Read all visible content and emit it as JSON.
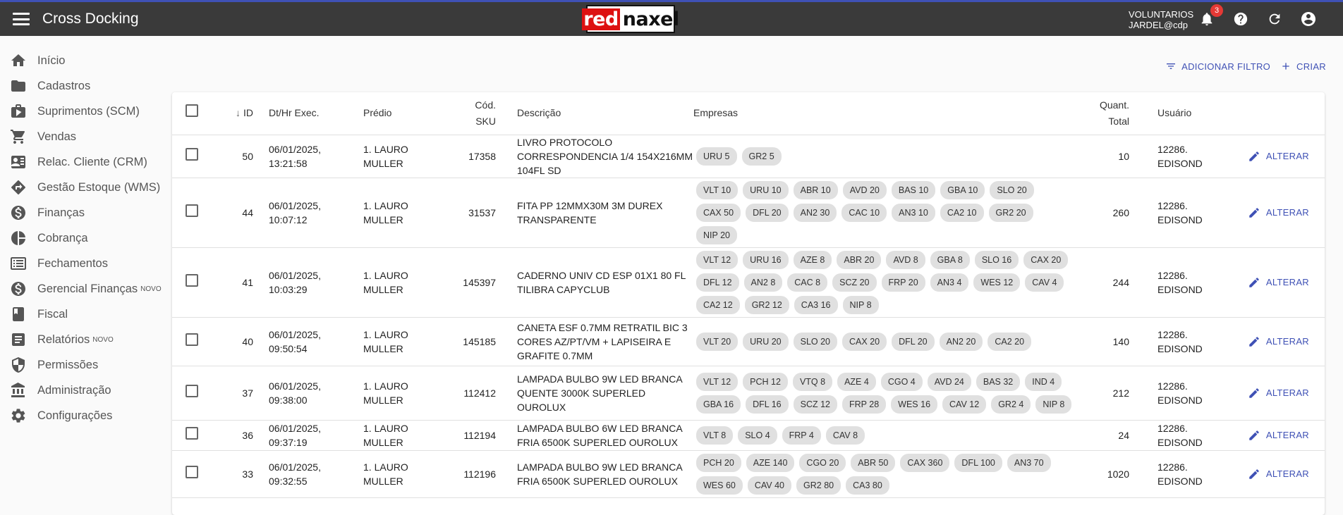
{
  "header": {
    "title": "Cross Docking",
    "logo_part1": "red",
    "logo_part2": "naxel",
    "user_line1": "VOLUNTARIOS",
    "user_line2": "JARDEL@cdp",
    "notification_count": "3"
  },
  "sidebar": {
    "items": [
      {
        "label": "Início",
        "icon": "home-icon"
      },
      {
        "label": "Cadastros",
        "icon": "folder-icon"
      },
      {
        "label": "Suprimentos (SCM)",
        "icon": "briefcase-icon"
      },
      {
        "label": "Vendas",
        "icon": "cart-icon"
      },
      {
        "label": "Relac. Cliente (CRM)",
        "icon": "contact-card-icon"
      },
      {
        "label": "Gestão Estoque (WMS)",
        "icon": "directions-icon"
      },
      {
        "label": "Finanças",
        "icon": "dollar-circle-icon"
      },
      {
        "label": "Cobrança",
        "icon": "pie-chart-icon"
      },
      {
        "label": "Fechamentos",
        "icon": "list-box-icon"
      },
      {
        "label": "Gerencial Finanças",
        "icon": "dollar-circle-icon",
        "sup": "NOVO"
      },
      {
        "label": "Fiscal",
        "icon": "book-icon"
      },
      {
        "label": "Relatórios",
        "icon": "report-icon",
        "sup": "NOVO"
      },
      {
        "label": "Permissões",
        "icon": "shield-icon"
      },
      {
        "label": "Administração",
        "icon": "bank-icon"
      },
      {
        "label": "Configurações",
        "icon": "gear-icon"
      }
    ]
  },
  "toolbar": {
    "filter_label": "ADICIONAR FILTRO",
    "create_label": "CRIAR"
  },
  "table": {
    "headers": {
      "id": "ID",
      "dt": "Dt/Hr Exec.",
      "predio": "Prédio",
      "sku_line1": "Cód.",
      "sku_line2": "SKU",
      "descricao": "Descrição",
      "empresas": "Empresas",
      "quant_line1": "Quant.",
      "quant_line2": "Total",
      "usuario": "Usuário"
    },
    "edit_label": "ALTERAR",
    "rows": [
      {
        "id": "50",
        "dt1": "06/01/2025,",
        "dt2": "13:21:58",
        "predio1": "1. LAURO",
        "predio2": "MULLER",
        "sku": "17358",
        "desc": "LIVRO PROTOCOLO CORRESPONDENCIA 1/4 154X216MM 104FL SD",
        "chips": [
          "URU 5",
          "GR2 5"
        ],
        "qt": "10",
        "usr1": "12286.",
        "usr2": "EDISOND"
      },
      {
        "id": "44",
        "dt1": "06/01/2025,",
        "dt2": "10:07:12",
        "predio1": "1. LAURO",
        "predio2": "MULLER",
        "sku": "31537",
        "desc": "FITA PP 12MMX30M 3M DUREX TRANSPARENTE",
        "chips": [
          "VLT 10",
          "URU 10",
          "ABR 10",
          "AVD 20",
          "BAS 10",
          "GBA 10",
          "SLO 20",
          "CAX 50",
          "DFL 20",
          "AN2 30",
          "CAC 10",
          "AN3 10",
          "CA2 10",
          "GR2 20",
          "NIP 20"
        ],
        "qt": "260",
        "usr1": "12286.",
        "usr2": "EDISOND"
      },
      {
        "id": "41",
        "dt1": "06/01/2025,",
        "dt2": "10:03:29",
        "predio1": "1. LAURO",
        "predio2": "MULLER",
        "sku": "145397",
        "desc": "CADERNO UNIV CD ESP 01X1 80 FL TILIBRA CAPYCLUB",
        "chips": [
          "VLT 12",
          "URU 16",
          "AZE 8",
          "ABR 20",
          "AVD 8",
          "GBA 8",
          "SLO 16",
          "CAX 20",
          "DFL 12",
          "AN2 8",
          "CAC 8",
          "SCZ 20",
          "FRP 20",
          "AN3 4",
          "WES 12",
          "CAV 4",
          "CA2 12",
          "GR2 12",
          "CA3 16",
          "NIP 8"
        ],
        "qt": "244",
        "usr1": "12286.",
        "usr2": "EDISOND"
      },
      {
        "id": "40",
        "dt1": "06/01/2025,",
        "dt2": "09:50:54",
        "predio1": "1. LAURO",
        "predio2": "MULLER",
        "sku": "145185",
        "desc": "CANETA ESF 0.7MM RETRATIL BIC 3 CORES AZ/PT/VM + LAPISEIRA E GRAFITE 0.7MM",
        "chips": [
          "VLT 20",
          "URU 20",
          "SLO 20",
          "CAX 20",
          "DFL 20",
          "AN2 20",
          "CA2 20"
        ],
        "qt": "140",
        "usr1": "12286.",
        "usr2": "EDISOND"
      },
      {
        "id": "37",
        "dt1": "06/01/2025,",
        "dt2": "09:38:00",
        "predio1": "1. LAURO",
        "predio2": "MULLER",
        "sku": "112412",
        "desc": "LAMPADA BULBO 9W LED BRANCA QUENTE 3000K SUPERLED OUROLUX",
        "chips": [
          "VLT 12",
          "PCH 12",
          "VTQ 8",
          "AZE 4",
          "CGO 4",
          "AVD 24",
          "BAS 32",
          "IND 4",
          "GBA 16",
          "DFL 16",
          "SCZ 12",
          "FRP 28",
          "WES 16",
          "CAV 12",
          "GR2 4",
          "NIP 8"
        ],
        "qt": "212",
        "usr1": "12286.",
        "usr2": "EDISOND"
      },
      {
        "id": "36",
        "dt1": "06/01/2025,",
        "dt2": "09:37:19",
        "predio1": "1. LAURO",
        "predio2": "MULLER",
        "sku": "112194",
        "desc": "LAMPADA BULBO 6W LED BRANCA FRIA 6500K SUPERLED OUROLUX",
        "chips": [
          "VLT 8",
          "SLO 4",
          "FRP 4",
          "CAV 8"
        ],
        "qt": "24",
        "usr1": "12286.",
        "usr2": "EDISOND"
      },
      {
        "id": "33",
        "dt1": "06/01/2025,",
        "dt2": "09:32:55",
        "predio1": "1. LAURO",
        "predio2": "MULLER",
        "sku": "112196",
        "desc": "LAMPADA BULBO 9W LED BRANCA FRIA 6500K SUPERLED OUROLUX",
        "chips": [
          "PCH 20",
          "AZE 140",
          "CGO 20",
          "ABR 50",
          "CAX 360",
          "DFL 100",
          "AN3 70",
          "WES 60",
          "CAV 40",
          "GR2 80",
          "CA3 80"
        ],
        "qt": "1020",
        "usr1": "12286.",
        "usr2": "EDISOND"
      }
    ]
  }
}
